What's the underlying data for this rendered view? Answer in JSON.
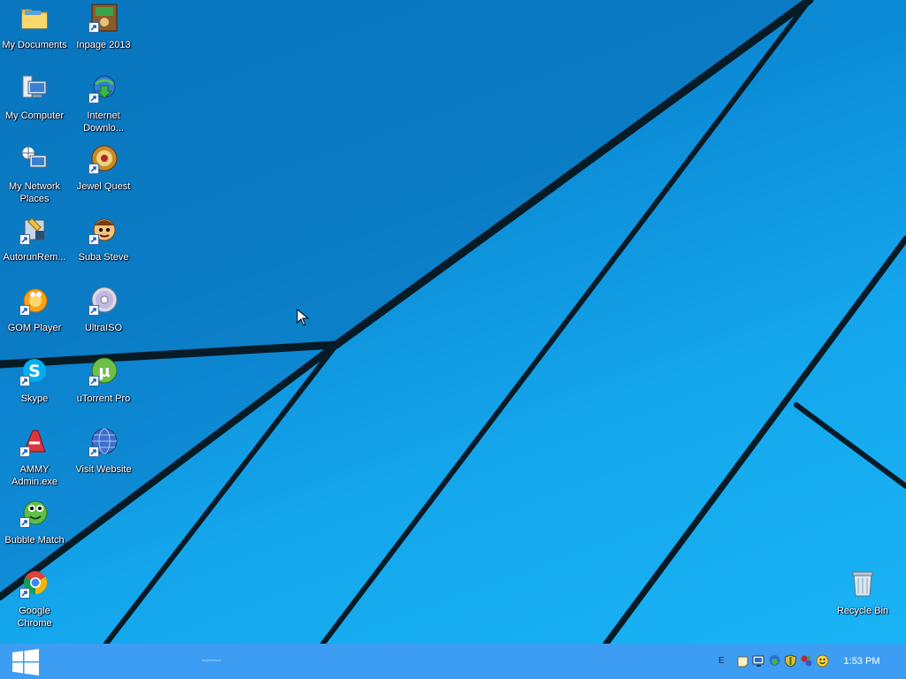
{
  "desktop": {
    "icons": [
      {
        "id": "my-documents",
        "label": "My Documents",
        "icon": "folder-icon"
      },
      {
        "id": "inpage-2013",
        "label": "Inpage 2013",
        "icon": "inpage-icon"
      },
      {
        "id": "my-computer",
        "label": "My Computer",
        "icon": "computer-icon"
      },
      {
        "id": "internet-download",
        "label": "Internet Downlo...",
        "icon": "internet-download-manager-icon"
      },
      {
        "id": "my-network-places",
        "label": "My Network Places",
        "icon": "network-icon"
      },
      {
        "id": "jewel-quest",
        "label": "Jewel Quest",
        "icon": "jewel-quest-icon"
      },
      {
        "id": "autorun-remover",
        "label": "AutorunRem...",
        "icon": "autorun-remover-icon"
      },
      {
        "id": "suba-steve",
        "label": "Suba Steve",
        "icon": "suba-steve-icon"
      },
      {
        "id": "gom-player",
        "label": "GOM Player",
        "icon": "gom-player-icon"
      },
      {
        "id": "ultraiso",
        "label": "UltraISO",
        "icon": "disc-icon"
      },
      {
        "id": "skype",
        "label": "Skype",
        "icon": "skype-icon"
      },
      {
        "id": "utorrent-pro",
        "label": "uTorrent Pro",
        "icon": "utorrent-icon"
      },
      {
        "id": "ammy-admin",
        "label": "AMMY Admin.exe",
        "icon": "ammy-admin-icon"
      },
      {
        "id": "visit-website",
        "label": "Visit Website",
        "icon": "globe-icon"
      },
      {
        "id": "bubble-match",
        "label": "Bubble Match",
        "icon": "bubble-match-icon"
      },
      {
        "id": "google-chrome",
        "label": "Google Chrome",
        "icon": "chrome-icon"
      },
      {
        "id": "recycle-bin",
        "label": "Recycle Bin",
        "icon": "recycle-bin-icon"
      }
    ]
  },
  "taskbar": {
    "start_icon": "windows-logo-icon",
    "tray_icons": [
      "language-indicator-icon",
      "notes-icon",
      "network-monitor-icon",
      "download-icon",
      "shield-icon",
      "utility-icon",
      "smiley-icon"
    ],
    "language_indicator": "E",
    "clock": "1:53 PM"
  },
  "colors": {
    "wallpaper": "#0c8bd6",
    "taskbar": "#3d9df3",
    "wallpaper_lines": "#071b26"
  }
}
